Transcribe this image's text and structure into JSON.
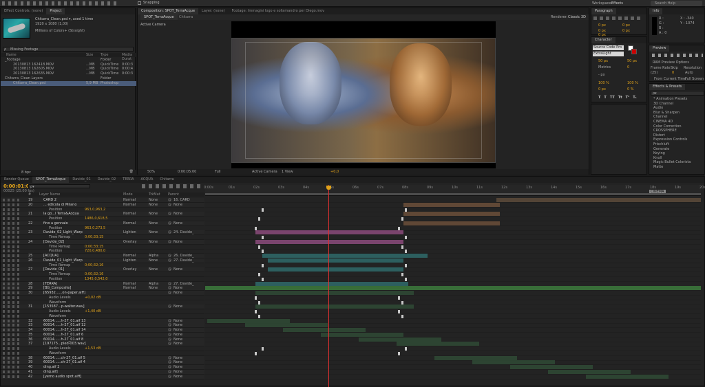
{
  "toolbar": {
    "snapping": "Snapping",
    "workspace_label": "Workspace:",
    "workspace_value": "Effects",
    "search_placeholder": "Search Help"
  },
  "project": {
    "tabs": [
      "Effect Controls: (none)",
      "Project"
    ],
    "asset_name": "Chitarra_Clean.psd ▾, used 1 time",
    "asset_size": "1920 x 1080 (1,00)",
    "asset_color": "Millions of Colors+ (Straight)",
    "search_value": "Missing Footage",
    "columns": [
      "Name",
      "Size",
      "Type",
      "Media Durat"
    ],
    "items": [
      {
        "name": "_Footage",
        "size": "",
        "type": "Folder",
        "dur": "",
        "indent": 0
      },
      {
        "name": "20130813 162418.MOV",
        "size": "...MB",
        "type": "QuickTime",
        "dur": "0:00:3",
        "indent": 1
      },
      {
        "name": "20130813 162605.MOV",
        "size": "...MB",
        "type": "QuickTime",
        "dur": "0:00:4",
        "indent": 1
      },
      {
        "name": "20130813 162635.MOV",
        "size": "...MB",
        "type": "QuickTime",
        "dur": "0:00:3",
        "indent": 1
      },
      {
        "name": "Chitarra_Clean Layers",
        "size": "",
        "type": "Folder",
        "dur": "",
        "indent": 0
      },
      {
        "name": "Chitarra_Clean.psd",
        "size": "5,9 MB",
        "type": "Photoshop",
        "dur": "",
        "indent": 1
      }
    ],
    "bpc": "8 bpc"
  },
  "comp": {
    "tabs": [
      "Composition: SPOT_TerraAcque",
      "Layer: (none)",
      "Footage: Immagini logo e sollamandro per Diego.mov"
    ],
    "subtabs": [
      "SPOT_TerraAcque",
      "Chitarra"
    ],
    "renderer_label": "Renderer:",
    "renderer_value": "Classic 3D",
    "active_camera": "Active Camera",
    "bottom": {
      "zoom": "50%",
      "timecode": "0:00:05:00",
      "res": "Full",
      "camera": "Active Camera",
      "view": "1 View",
      "offset": "+0,0"
    }
  },
  "paragraph": {
    "tab": "Paragraph",
    "values": [
      "0 px",
      "0 px",
      "0 px",
      "0 px",
      "0 px"
    ]
  },
  "character": {
    "tab": "Character",
    "font": "Source Code Pro",
    "style": "ExtraLight",
    "size": "50 px",
    "leading": "50 px",
    "kerning": "Metrics",
    "tracking": "0",
    "stroke": "- px",
    "vscale": "100 %",
    "hscale": "100 %",
    "baseline": "0 px",
    "tsume": "0 %",
    "style_buttons": [
      "T",
      "T",
      "TT",
      "Tt",
      "T¹",
      "T₁"
    ]
  },
  "info": {
    "tab": "Info",
    "r": "R :",
    "g": "G :",
    "b": "B :",
    "a": "A : 0",
    "x": "X : -340",
    "y": "Y : 1074"
  },
  "preview": {
    "tab": "Preview",
    "ram_options": "RAM Preview Options",
    "frame_rate_label": "Frame Rate",
    "skip_label": "Skip",
    "resolution_label": "Resolution",
    "frame_rate": "(25)",
    "skip": "0",
    "resolution": "Auto",
    "from_current": "From Current Time",
    "full_screen": "Full Screen"
  },
  "effects": {
    "tab": "Effects & Presets",
    "search_placeholder": "ρ▾",
    "items": [
      "* Animation Presets",
      "3D Channel",
      "Audio",
      "Blur & Sharpen",
      "Channel",
      "CINEMA 4D",
      "Color Correction",
      "CROSSPHERE",
      "Distort",
      "Expression Controls",
      "Frischluft",
      "Generate",
      "Keying",
      "Knoll",
      "Magic Bullet Colorista",
      "Matte"
    ]
  },
  "timeline": {
    "tabs": [
      "Render Queue",
      "SPOT_TerraAcque",
      "Davide_01",
      "Davide_02",
      "TERRA",
      "ACQUA",
      "Chitarra"
    ],
    "timecode": "0:00:01:00",
    "fps": "00025 (25.00 fps)",
    "search_placeholder": "ρ▾",
    "columns": {
      "num": "#",
      "name": "Layer Name",
      "mode": "Mode",
      "trkmat": "TrkMat",
      "parent": "Parent"
    },
    "ruler": [
      "0:00s",
      "01s",
      "02s",
      "03s",
      "04s",
      "05s",
      "06s",
      "07s",
      "08s",
      "09s",
      "10s",
      "11s",
      "12s",
      "13s",
      "14s",
      "15s",
      "16s",
      "17s",
      "18s",
      "19s",
      "20s"
    ],
    "end_label": "CINEMA",
    "layers": [
      {
        "num": "19",
        "name": "CARD 2",
        "mode": "Normal",
        "trk": "None",
        "parent": "16. CARD",
        "type": "layer"
      },
      {
        "num": "20",
        "name": "... edicola  di Milano",
        "mode": "Normal",
        "trk": "None",
        "parent": "None",
        "type": "layer"
      },
      {
        "num": "",
        "name": "Position",
        "val": "963,0,963,2",
        "type": "prop"
      },
      {
        "num": "21",
        "name": "la go...l  Terra&Acqua",
        "mode": "Normal",
        "trk": "None",
        "parent": "None",
        "type": "layer"
      },
      {
        "num": "",
        "name": "Position",
        "val": "1486,0,618,5",
        "type": "prop"
      },
      {
        "num": "22",
        "name": "fino a gennaio",
        "mode": "Normal",
        "trk": "None",
        "parent": "None",
        "type": "layer"
      },
      {
        "num": "",
        "name": "Position",
        "val": "963,0,273,5",
        "type": "prop"
      },
      {
        "num": "23",
        "name": "Davide_02_Light_Warp",
        "mode": "Lighten",
        "trk": "None",
        "parent": "24. Davide_",
        "type": "layer"
      },
      {
        "num": "",
        "name": "Time Remap",
        "val": "0;00;33;15",
        "type": "prop"
      },
      {
        "num": "24",
        "name": "[Davide_02]",
        "mode": "Overlay",
        "trk": "None",
        "parent": "None",
        "type": "layer"
      },
      {
        "num": "",
        "name": "Time Remap",
        "val": "0;00;33;15",
        "type": "prop"
      },
      {
        "num": "",
        "name": "Position",
        "val": "720,0,480,0",
        "type": "prop"
      },
      {
        "num": "25",
        "name": "[ACQUA]",
        "mode": "Normal",
        "trk": "Alpha",
        "parent": "26. Davide_",
        "type": "layer"
      },
      {
        "num": "26",
        "name": "Davide_01_Light_Warp",
        "mode": "Lighten",
        "trk": "None",
        "parent": "27. Davide_",
        "type": "layer"
      },
      {
        "num": "",
        "name": "Time Remap",
        "val": "0;00;32;16",
        "type": "prop"
      },
      {
        "num": "27",
        "name": "[Davide_01]",
        "mode": "Overlay",
        "trk": "None",
        "parent": "None",
        "type": "layer"
      },
      {
        "num": "",
        "name": "Time Remap",
        "val": "0;00;32;16",
        "type": "prop"
      },
      {
        "num": "",
        "name": "Position",
        "val": "1345,0,542,0",
        "type": "prop"
      },
      {
        "num": "28",
        "name": "[TERRA]",
        "mode": "Normal",
        "trk": "Alpha",
        "parent": "27. Davide_",
        "type": "layer"
      },
      {
        "num": "29",
        "name": "[BG_Composite]",
        "mode": "Normal",
        "trk": "None",
        "parent": "None",
        "type": "layer"
      },
      {
        "num": "30",
        "name": "[65932......on-paper.aiff]",
        "mode": "",
        "trk": "",
        "parent": "None",
        "type": "layer"
      },
      {
        "num": "",
        "name": "Audio Levels",
        "val": "+0,02 dB",
        "type": "prop"
      },
      {
        "num": "",
        "name": "Waveform",
        "val": "",
        "type": "prop"
      },
      {
        "num": "31",
        "name": "[153587...p-walter.wav]",
        "mode": "",
        "trk": "",
        "parent": "None",
        "type": "layer"
      },
      {
        "num": "",
        "name": "Audio Levels",
        "val": "+1,40 dB",
        "type": "prop"
      },
      {
        "num": "",
        "name": "Waveform",
        "val": "",
        "type": "prop"
      },
      {
        "num": "32",
        "name": "60014......h-27_01.aif 13",
        "mode": "",
        "trk": "",
        "parent": "None",
        "type": "layer"
      },
      {
        "num": "33",
        "name": "60014......h-27_01.aif 12",
        "mode": "",
        "trk": "",
        "parent": "None",
        "type": "layer"
      },
      {
        "num": "34",
        "name": "60014......h-27_01.aif 14",
        "mode": "",
        "trk": "",
        "parent": "None",
        "type": "layer"
      },
      {
        "num": "35",
        "name": "60014......h-27_01.aif 6",
        "mode": "",
        "trk": "",
        "parent": "None",
        "type": "layer"
      },
      {
        "num": "36",
        "name": "60014......h-27_01.aif 8",
        "mode": "",
        "trk": "",
        "parent": "None",
        "type": "layer"
      },
      {
        "num": "37",
        "name": "[197175...pled-003.wav]",
        "mode": "",
        "trk": "",
        "parent": "None",
        "type": "layer"
      },
      {
        "num": "",
        "name": "Audio Levels",
        "val": "+1,53 dB",
        "type": "prop"
      },
      {
        "num": "",
        "name": "Waveform",
        "val": "",
        "type": "prop"
      },
      {
        "num": "38",
        "name": "60014......ch-27_01.aif 5",
        "mode": "",
        "trk": "",
        "parent": "None",
        "type": "layer"
      },
      {
        "num": "39",
        "name": "60014......ch-27_01.aif 4",
        "mode": "",
        "trk": "",
        "parent": "None",
        "type": "layer"
      },
      {
        "num": "40",
        "name": "ding.aif 2",
        "mode": "",
        "trk": "",
        "parent": "None",
        "type": "layer"
      },
      {
        "num": "41",
        "name": "ding.aif]",
        "mode": "",
        "trk": "",
        "parent": "None",
        "type": "layer"
      },
      {
        "num": "42",
        "name": "[yemo audio spot.aiff]",
        "mode": "",
        "trk": "",
        "parent": "None",
        "type": "layer"
      }
    ]
  }
}
